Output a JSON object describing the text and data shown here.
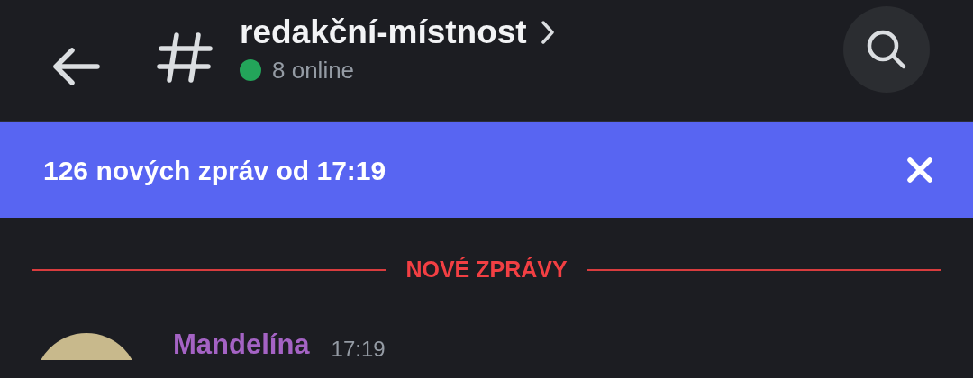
{
  "header": {
    "channel_name": "redakční-místnost",
    "online_count": "8 online"
  },
  "banner": {
    "text": "126 nových zpráv od 17:19"
  },
  "divider": {
    "label": "NOVÉ ZPRÁVY"
  },
  "messages": [
    {
      "author": "Mandelína",
      "color": "#a463c4",
      "time": "17:19"
    }
  ]
}
